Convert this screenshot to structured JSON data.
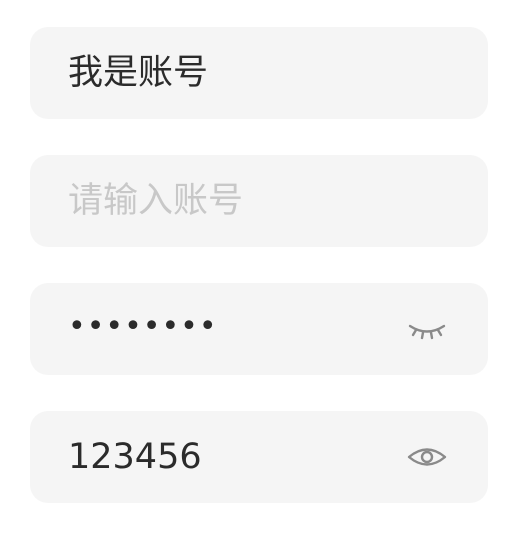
{
  "account_filled": {
    "value": "我是账号"
  },
  "account_empty": {
    "placeholder": "请输入账号"
  },
  "password_hidden": {
    "value": "••••••••",
    "toggle_icon": "eye-closed-icon"
  },
  "password_visible": {
    "value": "123456",
    "toggle_icon": "eye-open-icon"
  },
  "colors": {
    "field_background": "#f5f5f5",
    "text": "#2b2b2b",
    "placeholder": "#c8c8c8",
    "icon": "#8a8a8a"
  }
}
